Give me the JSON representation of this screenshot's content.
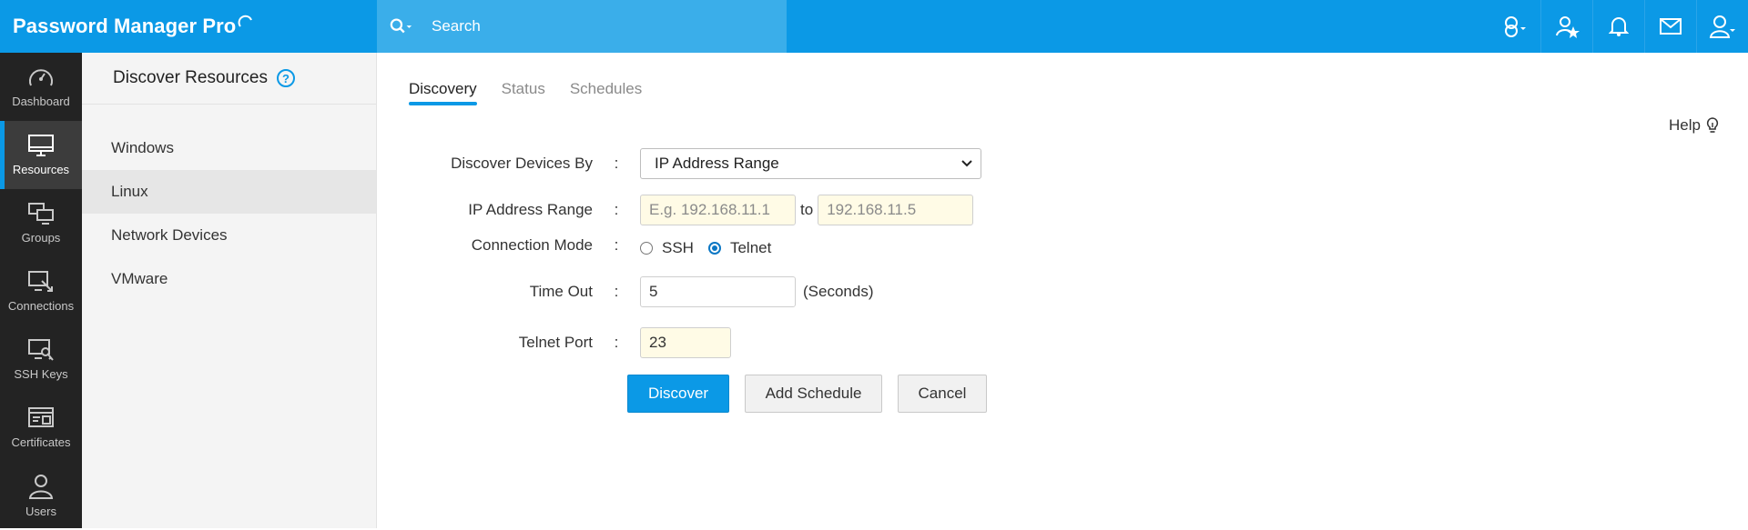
{
  "app": {
    "title": "Password Manager Pro"
  },
  "header": {
    "search_placeholder": "Search"
  },
  "rail": [
    {
      "label": "Dashboard"
    },
    {
      "label": "Resources"
    },
    {
      "label": "Groups"
    },
    {
      "label": "Connections"
    },
    {
      "label": "SSH Keys"
    },
    {
      "label": "Certificates"
    },
    {
      "label": "Users"
    }
  ],
  "subnav": {
    "title": "Discover Resources",
    "help_glyph": "?",
    "items": [
      {
        "label": "Windows"
      },
      {
        "label": "Linux"
      },
      {
        "label": "Network Devices"
      },
      {
        "label": "VMware"
      }
    ]
  },
  "tabs": [
    {
      "label": "Discovery"
    },
    {
      "label": "Status"
    },
    {
      "label": "Schedules"
    }
  ],
  "help_label": "Help",
  "form": {
    "discover_by": {
      "label": "Discover Devices By",
      "colon": ":",
      "value": "IP Address Range"
    },
    "ip_range": {
      "label": "IP Address Range",
      "colon": ":",
      "from_placeholder": "E.g. 192.168.11.1",
      "to_label": "to",
      "to_placeholder": "192.168.11.5"
    },
    "connection_mode": {
      "label": "Connection Mode",
      "colon": ":",
      "options": [
        "SSH",
        "Telnet"
      ],
      "selected": "Telnet"
    },
    "timeout": {
      "label": "Time Out",
      "colon": ":",
      "value": "5",
      "unit": "(Seconds)"
    },
    "telnet_port": {
      "label": "Telnet Port",
      "colon": ":",
      "value": "23"
    }
  },
  "buttons": {
    "discover": "Discover",
    "add_schedule": "Add Schedule",
    "cancel": "Cancel"
  },
  "colors": {
    "accent": "#0b99e6",
    "rail_bg": "#232323",
    "subnav_bg": "#f4f4f4",
    "input_highlight": "#fffbe6"
  }
}
